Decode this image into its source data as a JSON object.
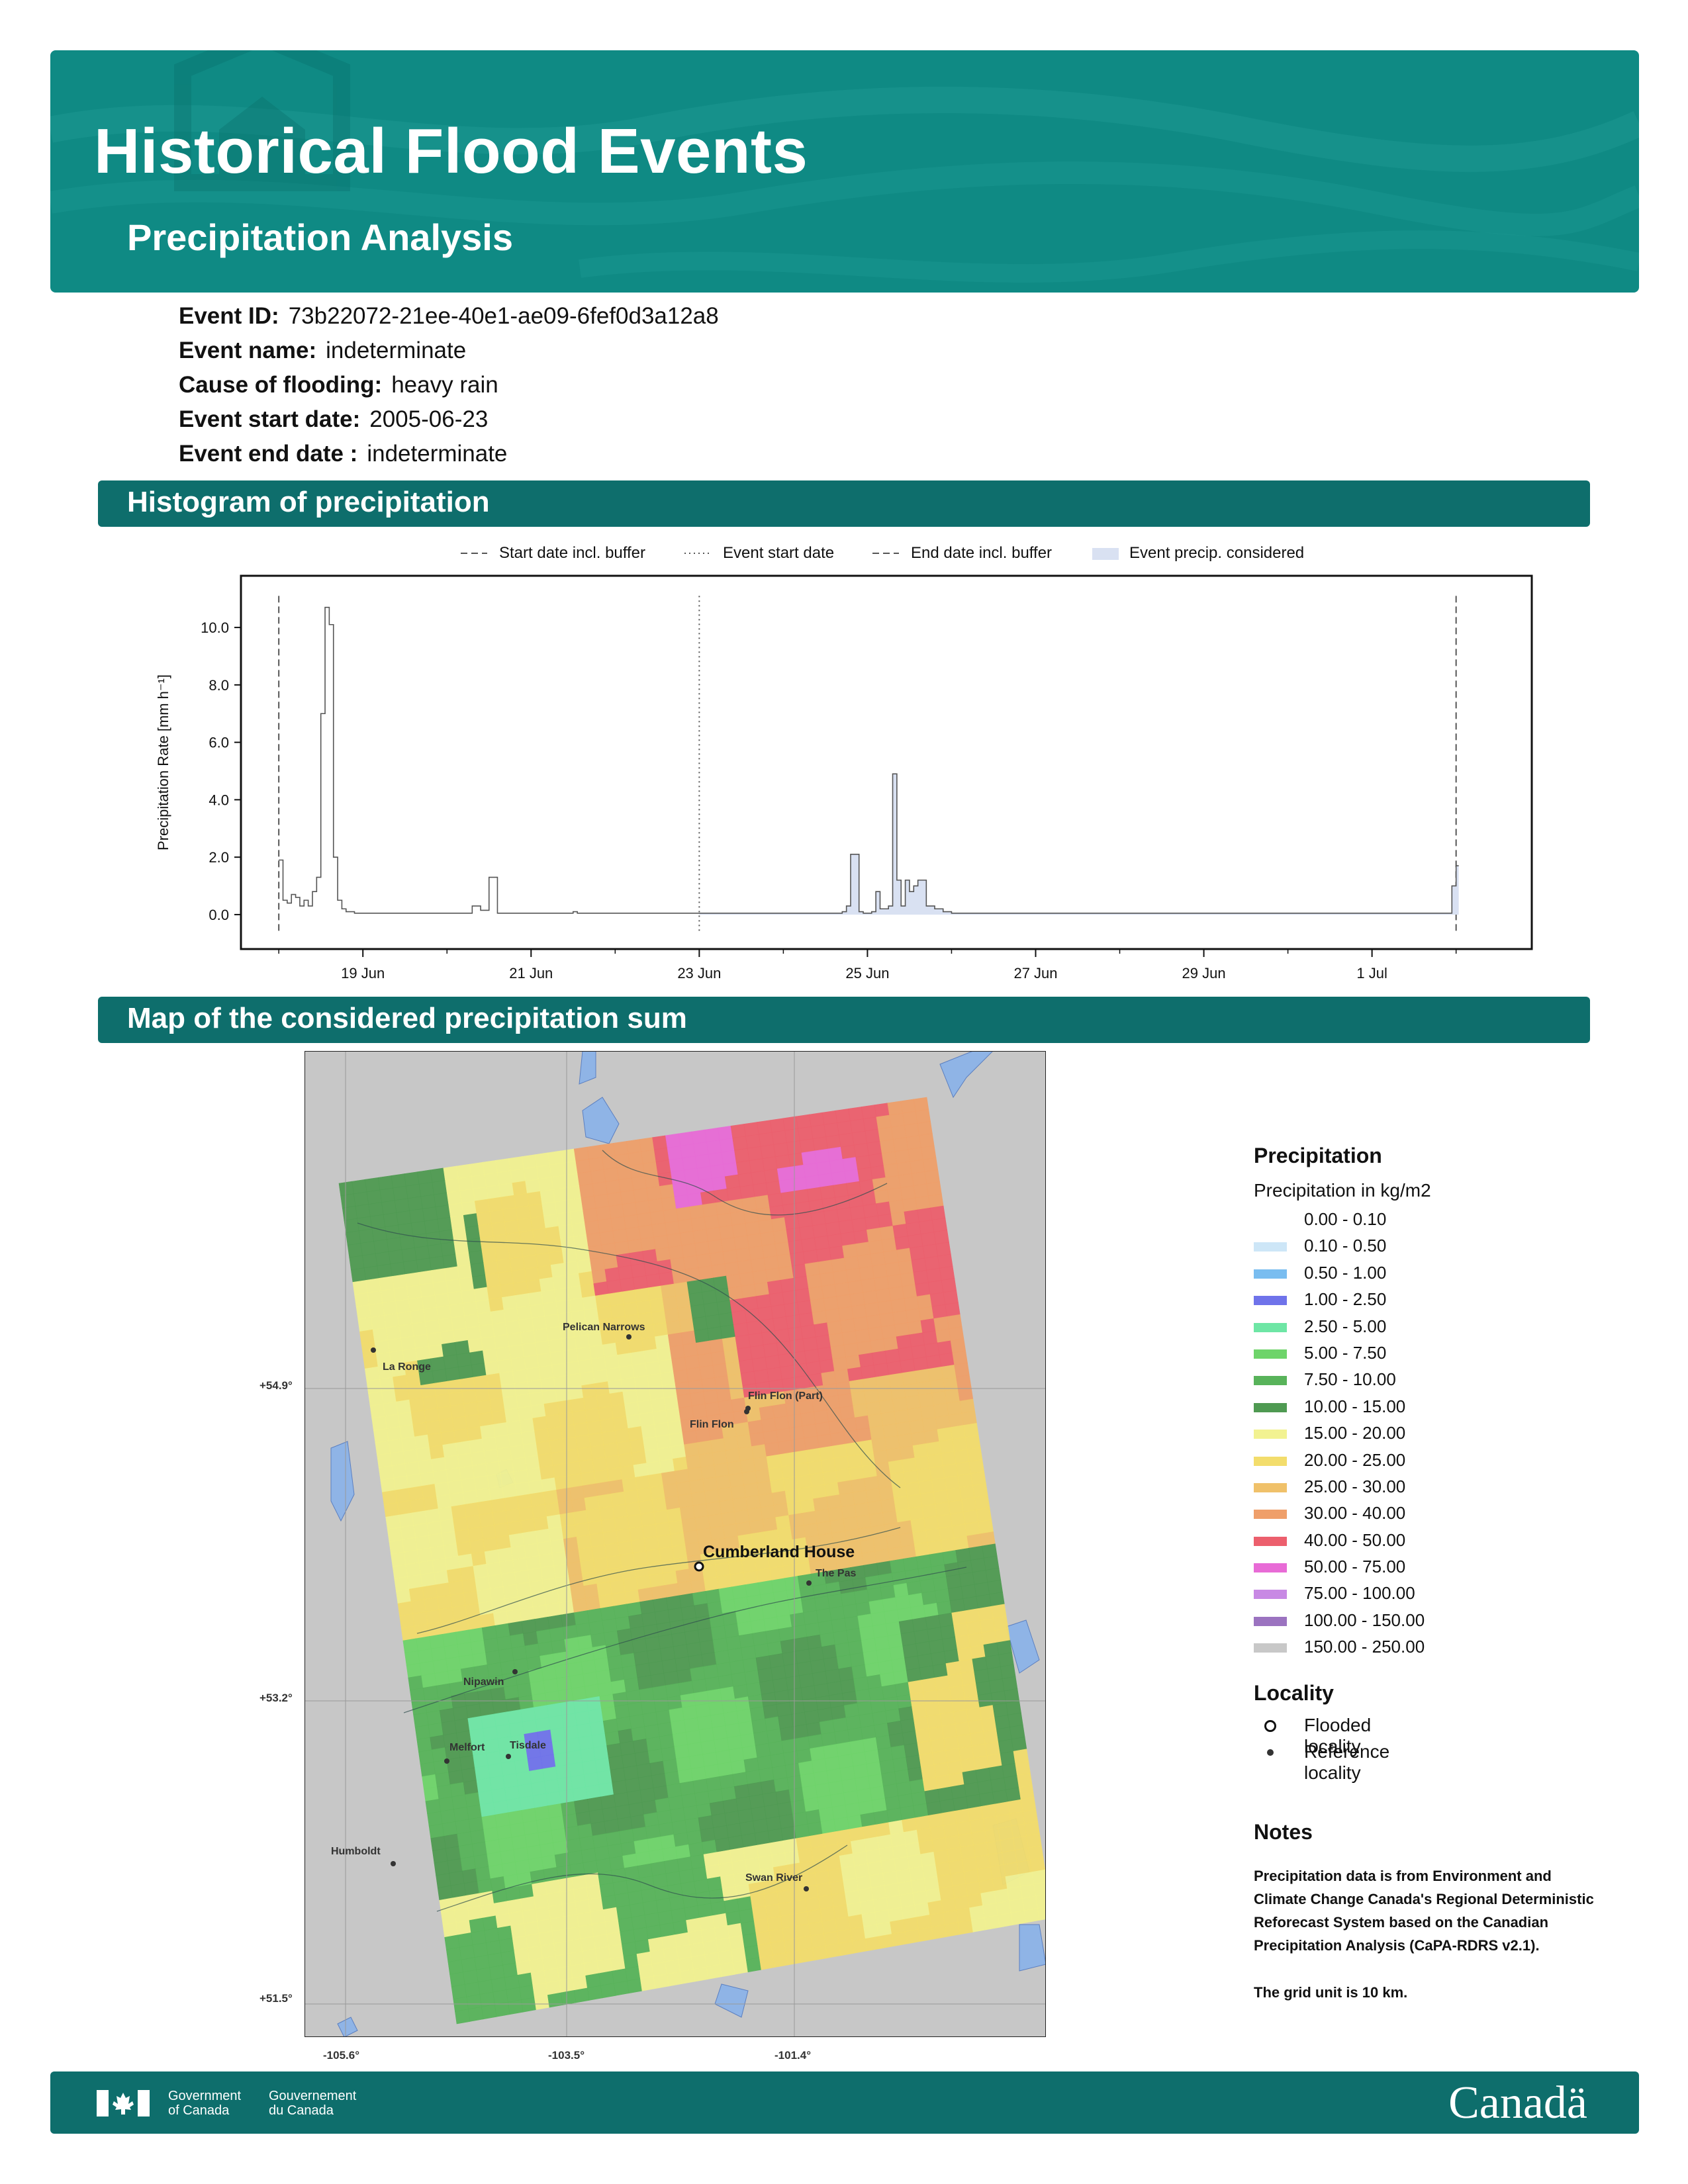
{
  "header": {
    "title": "Historical Flood Events",
    "subtitle": "Precipitation Analysis"
  },
  "event": {
    "id_label": "Event ID:",
    "id_value": "73b22072-21ee-40e1-ae09-6fef0d3a12a8",
    "name_label": "Event name:",
    "name_value": "indeterminate",
    "cause_label": "Cause of flooding:",
    "cause_value": "heavy rain",
    "start_label": "Event start date:",
    "start_value": "2005-06-23",
    "end_label": "Event end date :",
    "end_value": "indeterminate"
  },
  "sections": {
    "histogram_title": "Histogram of precipitation",
    "map_title": "Map of the considered precipitation sum"
  },
  "chart_legend": {
    "start_buffer": "Start date incl. buffer",
    "event_start": "Event start date",
    "end_buffer": "End date incl. buffer",
    "event_precip": "Event precip. considered"
  },
  "chart_data": {
    "type": "line",
    "title": "",
    "xlabel": "",
    "ylabel": "Precipitation Rate [mm h⁻¹]",
    "x_unit": "days since 2005-06-18 00:00",
    "xlim": [
      -0.45,
      14.9
    ],
    "ylim": [
      -1.2,
      11.8
    ],
    "y_ticks": [
      "0.0",
      "2.0",
      "4.0",
      "6.0",
      "8.0",
      "10.0"
    ],
    "x_ticks": [
      "19 Jun",
      "21 Jun",
      "23 Jun",
      "25 Jun",
      "27 Jun",
      "29 Jun",
      "1 Jul"
    ],
    "vlines": {
      "start_buffer": 0.0,
      "event_start": 5.0,
      "end_buffer": 14.0
    },
    "grid": false,
    "legend_position": "top",
    "series": [
      {
        "x": [
          0.0,
          0.05,
          0.1,
          0.15,
          0.2,
          0.25,
          0.3,
          0.35,
          0.4,
          0.45,
          0.5,
          0.55,
          0.6,
          0.65,
          0.7,
          0.75,
          0.8,
          0.85,
          0.9,
          0.95,
          1.0,
          1.1,
          1.2,
          1.4,
          1.6,
          1.8,
          2.0,
          2.2,
          2.3,
          2.4,
          2.5,
          2.6,
          2.8,
          3.0,
          3.2,
          3.4,
          3.5,
          3.55,
          3.6,
          3.65,
          3.7,
          3.8,
          4.0,
          4.5,
          5.0,
          5.5,
          5.9,
          6.0,
          6.05,
          6.1,
          6.2,
          6.5,
          6.7,
          6.75,
          6.8,
          6.9,
          6.95,
          7.0,
          7.05,
          7.1,
          7.15,
          7.2,
          7.25,
          7.3,
          7.35,
          7.4,
          7.45,
          7.5,
          7.55,
          7.6,
          7.7,
          7.8,
          7.9,
          8.0,
          8.2,
          8.5,
          9.0,
          9.5,
          10.0,
          10.5,
          11.0,
          11.5,
          12.0,
          12.5,
          13.0,
          13.5,
          13.9,
          13.95,
          14.0
        ],
        "y": [
          1.9,
          0.5,
          0.4,
          0.7,
          0.6,
          0.3,
          0.5,
          0.3,
          0.8,
          1.3,
          7.0,
          10.7,
          10.1,
          2.0,
          0.5,
          0.2,
          0.1,
          0.1,
          0.05,
          0.05,
          0.05,
          0.05,
          0.05,
          0.05,
          0.05,
          0.05,
          0.05,
          0.05,
          0.3,
          0.15,
          1.3,
          0.05,
          0.05,
          0.05,
          0.05,
          0.05,
          0.1,
          0.05,
          0.05,
          0.05,
          0.05,
          0.05,
          0.05,
          0.05,
          0.05,
          0.05,
          0.05,
          0.05,
          0.05,
          0.05,
          0.05,
          0.05,
          0.1,
          0.3,
          2.1,
          0.1,
          0.05,
          0.05,
          0.1,
          0.8,
          0.2,
          0.2,
          0.3,
          4.9,
          1.2,
          0.3,
          1.2,
          0.8,
          1.0,
          1.2,
          0.3,
          0.2,
          0.1,
          0.05,
          0.05,
          0.05,
          0.05,
          0.05,
          0.05,
          0.05,
          0.05,
          0.05,
          0.05,
          0.05,
          0.05,
          0.05,
          0.05,
          1.0,
          1.7
        ]
      }
    ]
  },
  "map": {
    "lat_labels": [
      "+54.9°",
      "+53.2°",
      "+51.5°"
    ],
    "lon_labels": [
      "-105.6°",
      "-103.5°",
      "-101.4°"
    ],
    "places": [
      {
        "name": "La Ronge"
      },
      {
        "name": "Pelican Narrows"
      },
      {
        "name": "Flin Flon (Part)"
      },
      {
        "name": "Flin Flon"
      },
      {
        "name": "Cumberland House"
      },
      {
        "name": "The Pas"
      },
      {
        "name": "Nipawin"
      },
      {
        "name": "Melfort"
      },
      {
        "name": "Tisdale"
      },
      {
        "name": "Humboldt"
      },
      {
        "name": "Swan River"
      }
    ]
  },
  "precip_legend": {
    "title": "Precipitation",
    "subtitle": "Precipitation in kg/m2",
    "items": [
      {
        "label": "0.00 - 0.10",
        "color": "#ffffff"
      },
      {
        "label": "0.10 - 0.50",
        "color": "#cde6f7"
      },
      {
        "label": "0.50 - 1.00",
        "color": "#79bdf0"
      },
      {
        "label": "1.00 - 2.50",
        "color": "#6f73ea"
      },
      {
        "label": "2.50 - 5.00",
        "color": "#6ee6a5"
      },
      {
        "label": "5.00 - 7.50",
        "color": "#6ed46a"
      },
      {
        "label": "7.50 - 10.00",
        "color": "#58b35a"
      },
      {
        "label": "10.00 - 15.00",
        "color": "#4f9a52"
      },
      {
        "label": "15.00 - 20.00",
        "color": "#f2f291"
      },
      {
        "label": "20.00 - 25.00",
        "color": "#f3dd6c"
      },
      {
        "label": "25.00 - 30.00",
        "color": "#f0c16a"
      },
      {
        "label": "30.00 - 40.00",
        "color": "#ef9f6a"
      },
      {
        "label": "40.00 - 50.00",
        "color": "#ec5f6d"
      },
      {
        "label": "50.00 - 75.00",
        "color": "#e86bd6"
      },
      {
        "label": "75.00 - 100.00",
        "color": "#c889e4"
      },
      {
        "label": "100.00 - 150.00",
        "color": "#9b73c0"
      },
      {
        "label": "150.00 - 250.00",
        "color": "#c8c8c8"
      }
    ]
  },
  "locality": {
    "title": "Locality",
    "flooded": "Flooded locality",
    "reference": "Reference locality"
  },
  "notes": {
    "title": "Notes",
    "body": "Precipitation data is from Environment and Climate Change Canada's Regional Deterministic Reforecast System based on the Canadian Precipitation Analysis (CaPA-RDRS v2.1).",
    "grid": "The grid unit is 10 km."
  },
  "footer": {
    "gov_en_1": "Government",
    "gov_en_2": "of Canada",
    "gov_fr_1": "Gouvernement",
    "gov_fr_2": "du Canada",
    "wordmark": "Canadä"
  }
}
